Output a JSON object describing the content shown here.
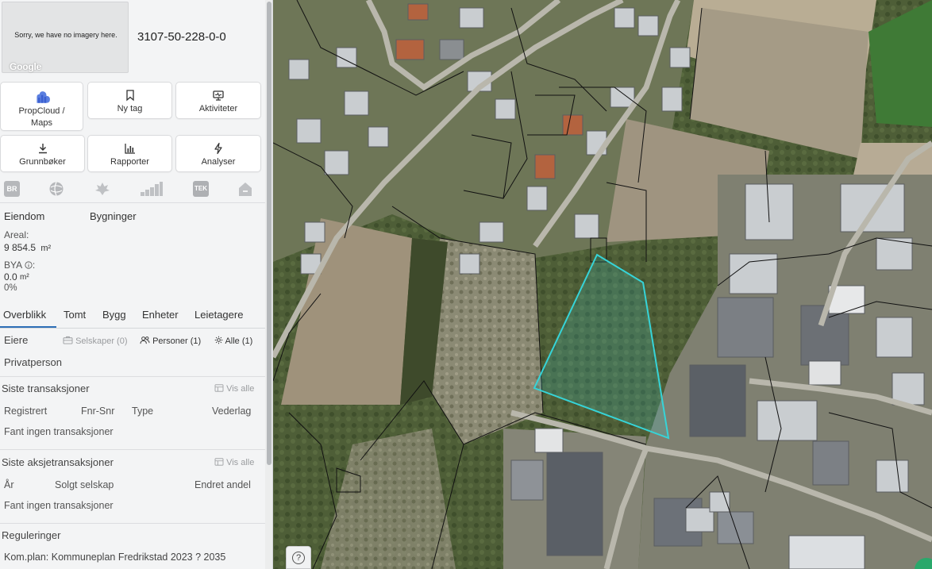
{
  "header": {
    "thumbnail_message": "Sorry, we have no imagery here.",
    "thumbnail_logo": "Google",
    "property_id": "3107-50-228-0-0"
  },
  "actions": [
    {
      "label": "PropCloud / Maps",
      "icon": "cloud-icon",
      "label1": "PropCloud /",
      "label2": "Maps"
    },
    {
      "label": "Ny tag",
      "icon": "bookmark-icon"
    },
    {
      "label": "Aktiviteter",
      "icon": "monitor-icon"
    },
    {
      "label": "Grunnbøker",
      "icon": "download-icon"
    },
    {
      "label": "Rapporter",
      "icon": "bar-chart-icon"
    },
    {
      "label": "Analyser",
      "icon": "lightning-icon"
    }
  ],
  "source_icons": {
    "br": "BR",
    "tek": "TEK"
  },
  "eiendom": {
    "tab1": "Eiendom",
    "tab2": "Bygninger",
    "areal_label": "Areal:",
    "areal_value": "9 854.5",
    "areal_unit": "m²",
    "bya_label": "BYA",
    "bya_suffix": ":",
    "bya_value": "0.0",
    "bya_unit": "m²",
    "bya_percent": "0%"
  },
  "tabs": [
    "Overblikk",
    "Tomt",
    "Bygg",
    "Enheter",
    "Leietagere"
  ],
  "owners": {
    "title": "Eiere",
    "companies": "Selskaper (0)",
    "persons": "Personer (1)",
    "all": "Alle (1)",
    "owner_type": "Privatperson"
  },
  "transactions": {
    "title": "Siste transaksjoner",
    "show_all": "Vis alle",
    "columns": [
      "Registrert",
      "Fnr-Snr",
      "Type",
      "Vederlag"
    ],
    "empty": "Fant ingen transaksjoner"
  },
  "share_transactions": {
    "title": "Siste aksjetransaksjoner",
    "show_all": "Vis alle",
    "columns": [
      "År",
      "Solgt selskap",
      "Endret andel"
    ],
    "empty": "Fant ingen transaksjoner"
  },
  "regulations": {
    "title": "Reguleringer",
    "line": "Kom.plan: Kommuneplan Fredrikstad 2023 ? 2035"
  },
  "map": {
    "help": "?",
    "selected_parcel_color": "#36d4d8"
  }
}
